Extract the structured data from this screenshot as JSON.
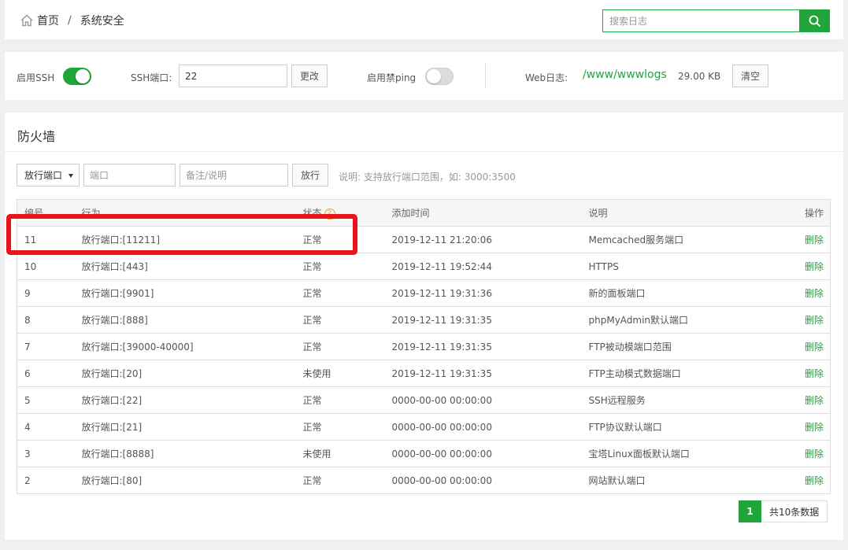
{
  "breadcrumb": {
    "home_label": "首页",
    "separator": "/",
    "current": "系统安全"
  },
  "search": {
    "placeholder": "搜索日志",
    "icon": "search-icon"
  },
  "ssh_bar": {
    "enable_ssh_label": "启用SSH",
    "enable_ssh_on": true,
    "port_label": "SSH端口:",
    "port_value": "22",
    "change_button": "更改",
    "ping_label": "启用禁ping",
    "ping_on": false,
    "weblog_label": "Web日志:",
    "weblog_path": "/www/wwwlogs",
    "weblog_size": "29.00 KB",
    "clear_button": "清空"
  },
  "firewall": {
    "title": "防火墙",
    "mode_select": "放行端口",
    "port_placeholder": "端口",
    "note_placeholder": "备注/说明",
    "allow_button": "放行",
    "hint": "说明: 支持放行端口范围，如: 3000:3500",
    "columns": [
      "编号",
      "行为",
      "状态",
      "添加时间",
      "说明",
      "操作"
    ],
    "rows": [
      {
        "id": "11",
        "action": "放行端口:[11211]",
        "status": "正常",
        "time": "2019-12-11 21:20:06",
        "desc": "Memcached服务端口",
        "op": "删除"
      },
      {
        "id": "10",
        "action": "放行端口:[443]",
        "status": "正常",
        "time": "2019-12-11 19:52:44",
        "desc": "HTTPS",
        "op": "删除"
      },
      {
        "id": "9",
        "action": "放行端口:[9901]",
        "status": "正常",
        "time": "2019-12-11 19:31:36",
        "desc": "新的面板端口",
        "op": "删除"
      },
      {
        "id": "8",
        "action": "放行端口:[888]",
        "status": "正常",
        "time": "2019-12-11 19:31:35",
        "desc": "phpMyAdmin默认端口",
        "op": "删除"
      },
      {
        "id": "7",
        "action": "放行端口:[39000-40000]",
        "status": "正常",
        "time": "2019-12-11 19:31:35",
        "desc": "FTP被动模端口范围",
        "op": "删除"
      },
      {
        "id": "6",
        "action": "放行端口:[20]",
        "status": "未使用",
        "time": "2019-12-11 19:31:35",
        "desc": "FTP主动模式数据端口",
        "op": "删除"
      },
      {
        "id": "5",
        "action": "放行端口:[22]",
        "status": "正常",
        "time": "0000-00-00 00:00:00",
        "desc": "SSH远程服务",
        "op": "删除"
      },
      {
        "id": "4",
        "action": "放行端口:[21]",
        "status": "正常",
        "time": "0000-00-00 00:00:00",
        "desc": "FTP协议默认端口",
        "op": "删除"
      },
      {
        "id": "3",
        "action": "放行端口:[8888]",
        "status": "未使用",
        "time": "0000-00-00 00:00:00",
        "desc": "宝塔Linux面板默认端口",
        "op": "删除"
      },
      {
        "id": "2",
        "action": "放行端口:[80]",
        "status": "正常",
        "time": "0000-00-00 00:00:00",
        "desc": "网站默认端口",
        "op": "删除"
      }
    ],
    "pager": {
      "current": "1",
      "total": "共10条数据"
    }
  },
  "colors": {
    "accent": "#20a53a",
    "highlight": "#e8141c",
    "help": "#f0a030"
  }
}
